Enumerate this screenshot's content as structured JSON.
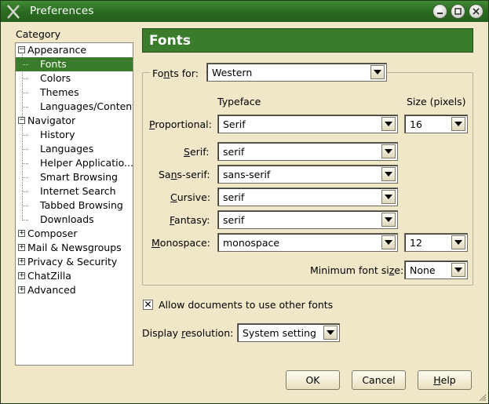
{
  "window": {
    "title": "Preferences",
    "icon": "gnome-x-icon"
  },
  "titlebar_buttons": {
    "minimize": "minimize-icon",
    "maximize": "maximize-icon",
    "close": "close-icon"
  },
  "sidebar": {
    "label": "Category",
    "items": [
      {
        "label": "Appearance",
        "expander": "⊟"
      },
      {
        "label": "Fonts"
      },
      {
        "label": "Colors"
      },
      {
        "label": "Themes"
      },
      {
        "label": "Languages/Content"
      },
      {
        "label": "Navigator",
        "expander": "⊟"
      },
      {
        "label": "History"
      },
      {
        "label": "Languages"
      },
      {
        "label": "Helper Applicatio..."
      },
      {
        "label": "Smart Browsing"
      },
      {
        "label": "Internet Search"
      },
      {
        "label": "Tabbed Browsing"
      },
      {
        "label": "Downloads"
      },
      {
        "label": "Composer",
        "expander": "⊞"
      },
      {
        "label": "Mail & Newsgroups",
        "expander": "⊞"
      },
      {
        "label": "Privacy & Security",
        "expander": "⊞"
      },
      {
        "label": "ChatZilla",
        "expander": "⊞"
      },
      {
        "label": "Advanced",
        "expander": "⊞"
      }
    ],
    "selected": "Fonts"
  },
  "header": {
    "title": "Fonts"
  },
  "fonts_for": {
    "pre": "Fo",
    "mnemonic": "n",
    "post": "ts for:",
    "value": "Western"
  },
  "columns": {
    "typeface": "Typeface",
    "size": "Size (pixels)"
  },
  "rows": {
    "proportional": {
      "mnemonic": "P",
      "rest": "roportional:",
      "value": "Serif",
      "size": "16"
    },
    "serif": {
      "mnemonic": "S",
      "rest": "erif:",
      "value": "serif"
    },
    "sans_serif": {
      "pre": "Sa",
      "mnemonic": "n",
      "post": "s-serif:",
      "value": "sans-serif"
    },
    "cursive": {
      "mnemonic": "C",
      "rest": "ursive:",
      "value": "serif"
    },
    "fantasy": {
      "mnemonic": "F",
      "rest": "antasy:",
      "value": "serif"
    },
    "monospace": {
      "mnemonic": "M",
      "rest": "onospace:",
      "value": "monospace",
      "size": "12"
    }
  },
  "min_font": {
    "pre": "Minimum font si",
    "mnemonic": "z",
    "post": "e:",
    "value": "None"
  },
  "allow_fonts": {
    "label": "Allow documents to use other fonts",
    "checked": true,
    "mark": "✕"
  },
  "display_resolution": {
    "pre": "Display ",
    "mnemonic": "r",
    "post": "esolution:",
    "value": "System setting"
  },
  "buttons": {
    "ok": "OK",
    "cancel": "Cancel",
    "help_mnemonic": "H",
    "help_rest": "elp"
  },
  "colors": {
    "accent": "#3a7b2c",
    "background": "#efe7c8",
    "titlebar": "#2a6a21"
  }
}
